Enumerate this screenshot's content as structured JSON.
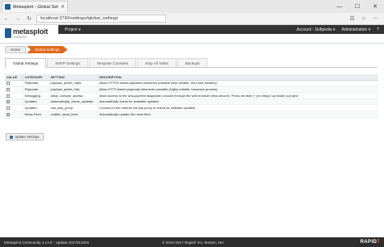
{
  "browser": {
    "tab_title": "Metasploit - Global Setti",
    "tab_close": "✕",
    "address": "localhost:3790/settings#global_settings",
    "back": "←",
    "forward": "→",
    "refresh": "↻",
    "min": "—",
    "max": "☐",
    "close": "✕"
  },
  "app": {
    "logo_text": "metasploit",
    "logo_sub": "community",
    "project_menu": "Project ▾",
    "account_menu": "Account - Softpedia ▾",
    "admin_menu": "Administration ▾",
    "help_label": "?"
  },
  "breadcrumb": {
    "home": "Home",
    "current": "Global Settings"
  },
  "tabs": [
    "Global Settings",
    "SMTP Settings",
    "Nexpose Consoles",
    "Stop All Tasks",
    "Backups"
  ],
  "table": {
    "headers": [
      "VALUE",
      "CATEGORY",
      "SETTING",
      "DESCRIPTION"
    ],
    "rows": [
      {
        "checked": false,
        "category": "Payloads",
        "setting": "payload_prefer_https",
        "description": "Allow HTTPS-based payloads whenever possible (less reliable, but more stealthy)"
      },
      {
        "checked": false,
        "category": "Payloads",
        "setting": "payload_prefer_http",
        "description": "Allow HTTP-based payloads whenever possible (highly reliable, traverses proxies)"
      },
      {
        "checked": false,
        "category": "Debugging",
        "setting": "allow_console_access",
        "description": "Allow access to the unsupported diagnostic console through the web browser (less secure). Press ctrl-tilde (~) to bring it up inside a project"
      },
      {
        "checked": true,
        "category": "Updates",
        "setting": "automatically_check_updates",
        "description": "Automatically check for available updates"
      },
      {
        "checked": false,
        "category": "Updates",
        "setting": "use_http_proxy",
        "description": "Connect to the internet via http proxy to check for software updates"
      },
      {
        "checked": true,
        "category": "News Feed",
        "setting": "enable_news_feed",
        "description": "Automatically update the news feed"
      }
    ]
  },
  "update_button": "Update Settings",
  "footer": {
    "version": "Metasploit Community 4.13.0 - Update 2017012501",
    "copyright": "© 2010-2017 Rapid7 Inc, Boston, MA",
    "brand_a": "RAPID",
    "brand_b": "7"
  }
}
